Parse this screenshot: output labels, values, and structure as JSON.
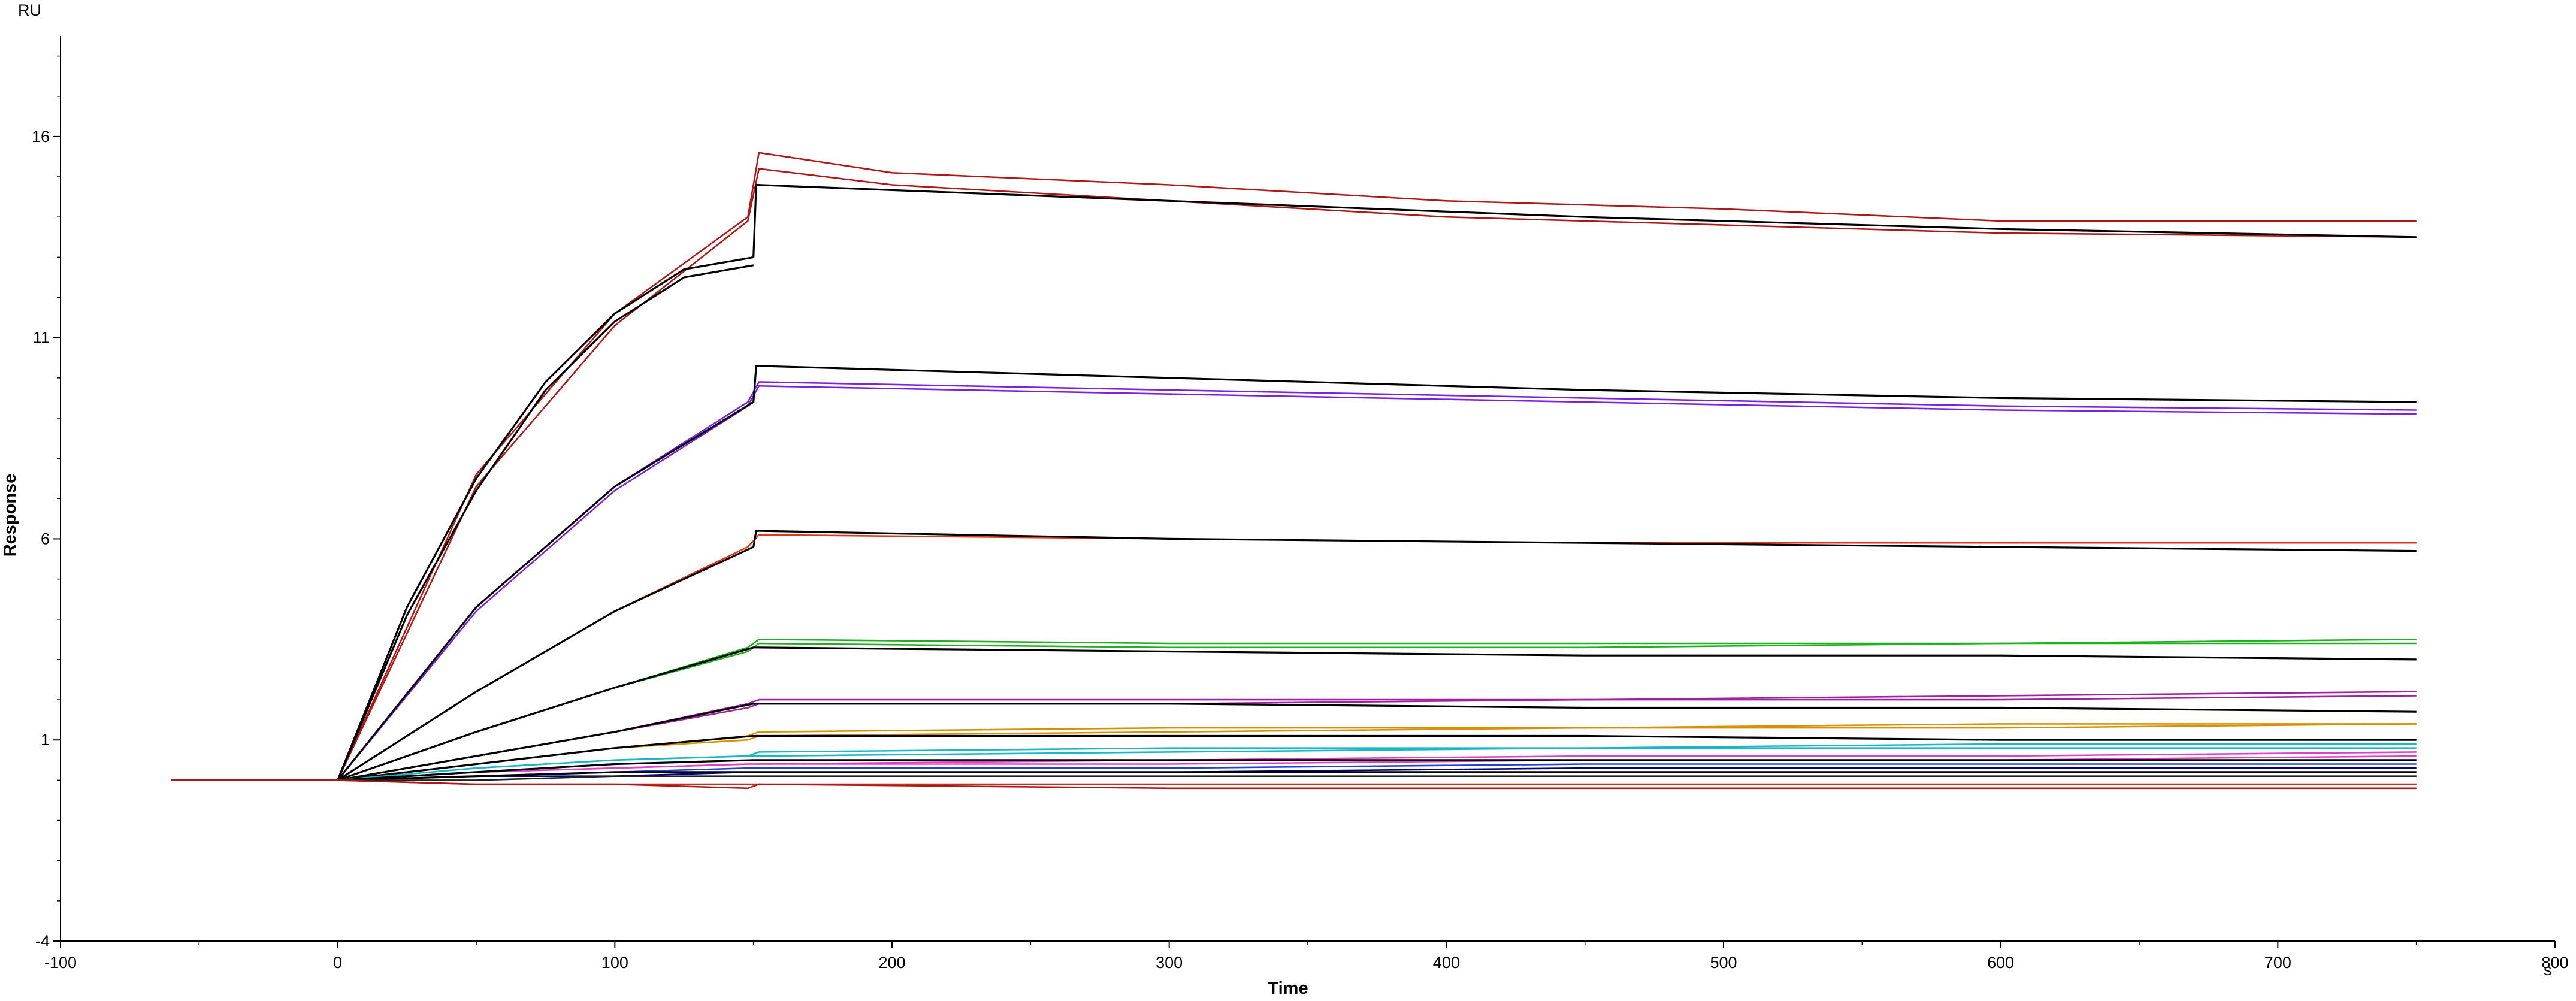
{
  "chart_data": {
    "type": "line",
    "xlabel": "Time",
    "ylabel": "Response",
    "x_unit": "s",
    "y_unit": "RU",
    "xlim": [
      -100,
      800
    ],
    "ylim": [
      -4,
      18.5
    ],
    "x_ticks": [
      -100,
      0,
      100,
      200,
      300,
      400,
      500,
      600,
      700,
      800
    ],
    "y_ticks": [
      -4,
      1,
      6,
      11,
      16
    ],
    "x_tick_labels": [
      "-100",
      "0",
      "100",
      "200",
      "300",
      "400",
      "500",
      "600",
      "700",
      "800"
    ],
    "y_tick_labels": [
      "-4",
      "1",
      "6",
      "11",
      "16"
    ],
    "grid": false,
    "legend": "none",
    "baseline_value": 0,
    "association_end": 150,
    "baseline_start": -60,
    "run_end": 750,
    "series": [
      {
        "color": "#b01818",
        "kind": "measured",
        "values": [
          [
            0,
            0
          ],
          [
            50,
            7.6
          ],
          [
            100,
            11.6
          ],
          [
            148,
            14.0
          ],
          [
            152,
            15.6
          ],
          [
            200,
            15.1
          ],
          [
            300,
            14.8
          ],
          [
            400,
            14.4
          ],
          [
            500,
            14.2
          ],
          [
            600,
            13.9
          ],
          [
            750,
            13.9
          ]
        ]
      },
      {
        "color": "#b01818",
        "kind": "measured",
        "values": [
          [
            0,
            0
          ],
          [
            50,
            7.3
          ],
          [
            100,
            11.3
          ],
          [
            148,
            13.9
          ],
          [
            152,
            15.2
          ],
          [
            200,
            14.8
          ],
          [
            300,
            14.4
          ],
          [
            400,
            14.0
          ],
          [
            500,
            13.8
          ],
          [
            600,
            13.6
          ],
          [
            750,
            13.5
          ]
        ]
      },
      {
        "color": "#000000",
        "kind": "fit",
        "values": [
          [
            0,
            0
          ],
          [
            25,
            4.3
          ],
          [
            50,
            7.5
          ],
          [
            75,
            9.9
          ],
          [
            100,
            11.6
          ],
          [
            125,
            12.7
          ],
          [
            150,
            13.0
          ],
          [
            151,
            14.8
          ],
          [
            300,
            14.4
          ],
          [
            450,
            14.0
          ],
          [
            600,
            13.7
          ],
          [
            750,
            13.5
          ]
        ]
      },
      {
        "color": "#000000",
        "kind": "fit",
        "values": [
          [
            0,
            0
          ],
          [
            25,
            4.1
          ],
          [
            50,
            7.2
          ],
          [
            75,
            9.7
          ],
          [
            100,
            11.4
          ],
          [
            125,
            12.5
          ],
          [
            150,
            12.8
          ]
        ]
      },
      {
        "color": "#7b22e0",
        "kind": "measured",
        "values": [
          [
            0,
            0
          ],
          [
            50,
            4.3
          ],
          [
            100,
            7.3
          ],
          [
            148,
            9.4
          ],
          [
            152,
            9.9
          ],
          [
            300,
            9.7
          ],
          [
            450,
            9.5
          ],
          [
            600,
            9.3
          ],
          [
            750,
            9.2
          ]
        ]
      },
      {
        "color": "#7b22e0",
        "kind": "measured",
        "values": [
          [
            0,
            0
          ],
          [
            50,
            4.2
          ],
          [
            100,
            7.2
          ],
          [
            148,
            9.3
          ],
          [
            152,
            9.8
          ],
          [
            300,
            9.6
          ],
          [
            450,
            9.4
          ],
          [
            600,
            9.2
          ],
          [
            750,
            9.1
          ]
        ]
      },
      {
        "color": "#000000",
        "kind": "fit",
        "values": [
          [
            0,
            0
          ],
          [
            50,
            4.3
          ],
          [
            100,
            7.3
          ],
          [
            150,
            9.4
          ],
          [
            151,
            10.3
          ],
          [
            300,
            10.0
          ],
          [
            450,
            9.7
          ],
          [
            600,
            9.5
          ],
          [
            750,
            9.4
          ]
        ]
      },
      {
        "color": "#e03818",
        "kind": "measured",
        "values": [
          [
            0,
            0
          ],
          [
            50,
            2.2
          ],
          [
            100,
            4.2
          ],
          [
            148,
            5.8
          ],
          [
            152,
            6.1
          ],
          [
            300,
            6.0
          ],
          [
            450,
            5.9
          ],
          [
            600,
            5.9
          ],
          [
            750,
            5.9
          ]
        ]
      },
      {
        "color": "#000000",
        "kind": "fit",
        "values": [
          [
            0,
            0
          ],
          [
            50,
            2.2
          ],
          [
            100,
            4.2
          ],
          [
            150,
            5.8
          ],
          [
            151,
            6.2
          ],
          [
            300,
            6.0
          ],
          [
            450,
            5.9
          ],
          [
            600,
            5.8
          ],
          [
            750,
            5.7
          ]
        ]
      },
      {
        "color": "#22b022",
        "kind": "measured",
        "values": [
          [
            0,
            0
          ],
          [
            50,
            1.2
          ],
          [
            100,
            2.3
          ],
          [
            148,
            3.3
          ],
          [
            152,
            3.5
          ],
          [
            300,
            3.4
          ],
          [
            450,
            3.4
          ],
          [
            600,
            3.4
          ],
          [
            750,
            3.5
          ]
        ]
      },
      {
        "color": "#22b022",
        "kind": "measured",
        "values": [
          [
            0,
            0
          ],
          [
            50,
            1.2
          ],
          [
            100,
            2.3
          ],
          [
            148,
            3.2
          ],
          [
            152,
            3.4
          ],
          [
            300,
            3.3
          ],
          [
            450,
            3.3
          ],
          [
            600,
            3.4
          ],
          [
            750,
            3.4
          ]
        ]
      },
      {
        "color": "#000000",
        "kind": "fit",
        "values": [
          [
            0,
            0
          ],
          [
            50,
            1.2
          ],
          [
            100,
            2.3
          ],
          [
            150,
            3.3
          ],
          [
            151,
            3.3
          ],
          [
            300,
            3.2
          ],
          [
            450,
            3.1
          ],
          [
            600,
            3.1
          ],
          [
            750,
            3.0
          ]
        ]
      },
      {
        "color": "#a020a0",
        "kind": "measured",
        "values": [
          [
            0,
            0
          ],
          [
            50,
            0.6
          ],
          [
            100,
            1.2
          ],
          [
            148,
            1.9
          ],
          [
            152,
            2.0
          ],
          [
            300,
            2.0
          ],
          [
            450,
            2.0
          ],
          [
            600,
            2.1
          ],
          [
            750,
            2.2
          ]
        ]
      },
      {
        "color": "#a020a0",
        "kind": "measured",
        "values": [
          [
            0,
            0
          ],
          [
            50,
            0.6
          ],
          [
            100,
            1.2
          ],
          [
            148,
            1.8
          ],
          [
            152,
            1.9
          ],
          [
            300,
            1.9
          ],
          [
            450,
            2.0
          ],
          [
            600,
            2.0
          ],
          [
            750,
            2.1
          ]
        ]
      },
      {
        "color": "#000000",
        "kind": "fit",
        "values": [
          [
            0,
            0
          ],
          [
            50,
            0.6
          ],
          [
            100,
            1.2
          ],
          [
            150,
            1.9
          ],
          [
            151,
            1.9
          ],
          [
            300,
            1.9
          ],
          [
            450,
            1.8
          ],
          [
            600,
            1.8
          ],
          [
            750,
            1.7
          ]
        ]
      },
      {
        "color": "#d89000",
        "kind": "measured",
        "values": [
          [
            0,
            0
          ],
          [
            50,
            0.4
          ],
          [
            100,
            0.8
          ],
          [
            148,
            1.1
          ],
          [
            152,
            1.2
          ],
          [
            300,
            1.3
          ],
          [
            450,
            1.3
          ],
          [
            600,
            1.4
          ],
          [
            750,
            1.4
          ]
        ]
      },
      {
        "color": "#d89000",
        "kind": "measured",
        "values": [
          [
            0,
            0
          ],
          [
            50,
            0.4
          ],
          [
            100,
            0.8
          ],
          [
            148,
            1.0
          ],
          [
            152,
            1.1
          ],
          [
            300,
            1.2
          ],
          [
            450,
            1.3
          ],
          [
            600,
            1.3
          ],
          [
            750,
            1.4
          ]
        ]
      },
      {
        "color": "#000000",
        "kind": "fit",
        "values": [
          [
            0,
            0
          ],
          [
            50,
            0.4
          ],
          [
            100,
            0.8
          ],
          [
            150,
            1.1
          ],
          [
            151,
            1.1
          ],
          [
            300,
            1.1
          ],
          [
            450,
            1.1
          ],
          [
            600,
            1.0
          ],
          [
            750,
            1.0
          ]
        ]
      },
      {
        "color": "#18b8c8",
        "kind": "measured",
        "values": [
          [
            0,
            0
          ],
          [
            50,
            0.3
          ],
          [
            100,
            0.5
          ],
          [
            148,
            0.6
          ],
          [
            152,
            0.7
          ],
          [
            300,
            0.8
          ],
          [
            450,
            0.8
          ],
          [
            600,
            0.9
          ],
          [
            750,
            0.9
          ]
        ]
      },
      {
        "color": "#18b8c8",
        "kind": "measured",
        "values": [
          [
            0,
            0
          ],
          [
            50,
            0.3
          ],
          [
            100,
            0.5
          ],
          [
            148,
            0.6
          ],
          [
            152,
            0.6
          ],
          [
            300,
            0.7
          ],
          [
            450,
            0.8
          ],
          [
            600,
            0.8
          ],
          [
            750,
            0.8
          ]
        ]
      },
      {
        "color": "#e040c8",
        "kind": "measured",
        "values": [
          [
            0,
            0
          ],
          [
            50,
            0.2
          ],
          [
            100,
            0.3
          ],
          [
            148,
            0.4
          ],
          [
            152,
            0.4
          ],
          [
            300,
            0.5
          ],
          [
            450,
            0.6
          ],
          [
            600,
            0.6
          ],
          [
            750,
            0.7
          ]
        ]
      },
      {
        "color": "#e040c8",
        "kind": "measured",
        "values": [
          [
            0,
            0
          ],
          [
            50,
            0.2
          ],
          [
            100,
            0.3
          ],
          [
            148,
            0.4
          ],
          [
            152,
            0.4
          ],
          [
            300,
            0.4
          ],
          [
            450,
            0.5
          ],
          [
            600,
            0.5
          ],
          [
            750,
            0.6
          ]
        ]
      },
      {
        "color": "#000000",
        "kind": "fit",
        "values": [
          [
            0,
            0
          ],
          [
            50,
            0.2
          ],
          [
            100,
            0.4
          ],
          [
            150,
            0.5
          ],
          [
            151,
            0.5
          ],
          [
            300,
            0.5
          ],
          [
            450,
            0.5
          ],
          [
            600,
            0.5
          ],
          [
            750,
            0.5
          ]
        ]
      },
      {
        "color": "#2040d8",
        "kind": "measured",
        "values": [
          [
            0,
            0
          ],
          [
            50,
            0.1
          ],
          [
            100,
            0.2
          ],
          [
            148,
            0.3
          ],
          [
            152,
            0.3
          ],
          [
            300,
            0.3
          ],
          [
            450,
            0.4
          ],
          [
            600,
            0.4
          ],
          [
            750,
            0.4
          ]
        ]
      },
      {
        "color": "#000080",
        "kind": "measured",
        "values": [
          [
            0,
            0
          ],
          [
            50,
            0.1
          ],
          [
            100,
            0.1
          ],
          [
            148,
            0.2
          ],
          [
            152,
            0.2
          ],
          [
            300,
            0.2
          ],
          [
            450,
            0.3
          ],
          [
            600,
            0.3
          ],
          [
            750,
            0.3
          ]
        ]
      },
      {
        "color": "#000000",
        "kind": "fit",
        "values": [
          [
            0,
            0
          ],
          [
            50,
            0.1
          ],
          [
            100,
            0.2
          ],
          [
            150,
            0.2
          ],
          [
            151,
            0.2
          ],
          [
            300,
            0.2
          ],
          [
            450,
            0.2
          ],
          [
            600,
            0.2
          ],
          [
            750,
            0.2
          ]
        ]
      },
      {
        "color": "#202020",
        "kind": "measured",
        "values": [
          [
            0,
            0
          ],
          [
            50,
            0.0
          ],
          [
            100,
            0.1
          ],
          [
            148,
            0.1
          ],
          [
            152,
            0.1
          ],
          [
            300,
            0.1
          ],
          [
            450,
            0.1
          ],
          [
            600,
            0.1
          ],
          [
            750,
            0.1
          ]
        ]
      },
      {
        "color": "#c03020",
        "kind": "measured",
        "values": [
          [
            0,
            0
          ],
          [
            50,
            -0.1
          ],
          [
            100,
            -0.1
          ],
          [
            148,
            -0.1
          ],
          [
            152,
            -0.1
          ],
          [
            300,
            -0.1
          ],
          [
            450,
            -0.1
          ],
          [
            600,
            -0.1
          ],
          [
            750,
            -0.1
          ]
        ]
      },
      {
        "color": "#b01818",
        "kind": "measured",
        "values": [
          [
            0,
            0
          ],
          [
            50,
            -0.1
          ],
          [
            100,
            -0.1
          ],
          [
            148,
            -0.2
          ],
          [
            152,
            -0.1
          ],
          [
            300,
            -0.2
          ],
          [
            450,
            -0.2
          ],
          [
            600,
            -0.2
          ],
          [
            750,
            -0.2
          ]
        ]
      }
    ]
  }
}
